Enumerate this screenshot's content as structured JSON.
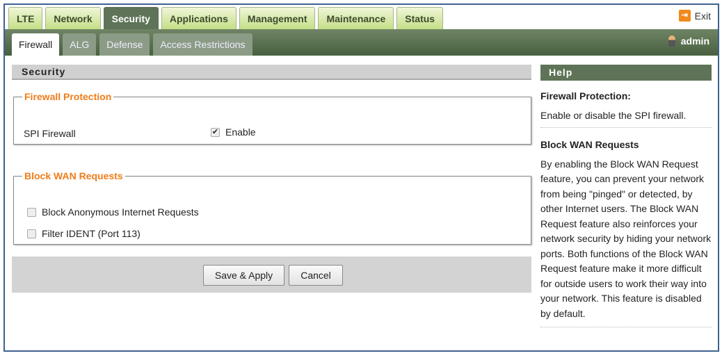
{
  "top_tabs": [
    "LTE",
    "Network",
    "Security",
    "Applications",
    "Management",
    "Maintenance",
    "Status"
  ],
  "active_top_tab": "Security",
  "exit_label": "Exit",
  "sub_tabs": [
    "Firewall",
    "ALG",
    "Defense",
    "Access Restrictions"
  ],
  "active_sub_tab": "Firewall",
  "user": "admin",
  "section_title": "Security",
  "firewall": {
    "legend": "Firewall Protection",
    "label": "SPI Firewall",
    "checkbox_label": "Enable",
    "checked": true
  },
  "block_wan": {
    "legend": "Block WAN Requests",
    "items": [
      {
        "label": "Block Anonymous Internet Requests",
        "checked": false
      },
      {
        "label": "Filter IDENT (Port 113)",
        "checked": false
      }
    ]
  },
  "buttons": {
    "save": "Save & Apply",
    "cancel": "Cancel"
  },
  "help": {
    "title": "Help",
    "sections": [
      {
        "title": "Firewall Protection:",
        "text": "Enable or disable the SPI firewall."
      },
      {
        "title": "Block WAN Requests",
        "text": "By enabling the Block WAN Request feature, you can prevent your network from being \"pinged\" or detected, by other Internet users. The Block WAN Request feature also reinforces your network security by hiding your network ports. Both functions of the Block WAN Request feature make it more difficult for outside users to work their way into your network. This feature is disabled by default."
      }
    ]
  }
}
